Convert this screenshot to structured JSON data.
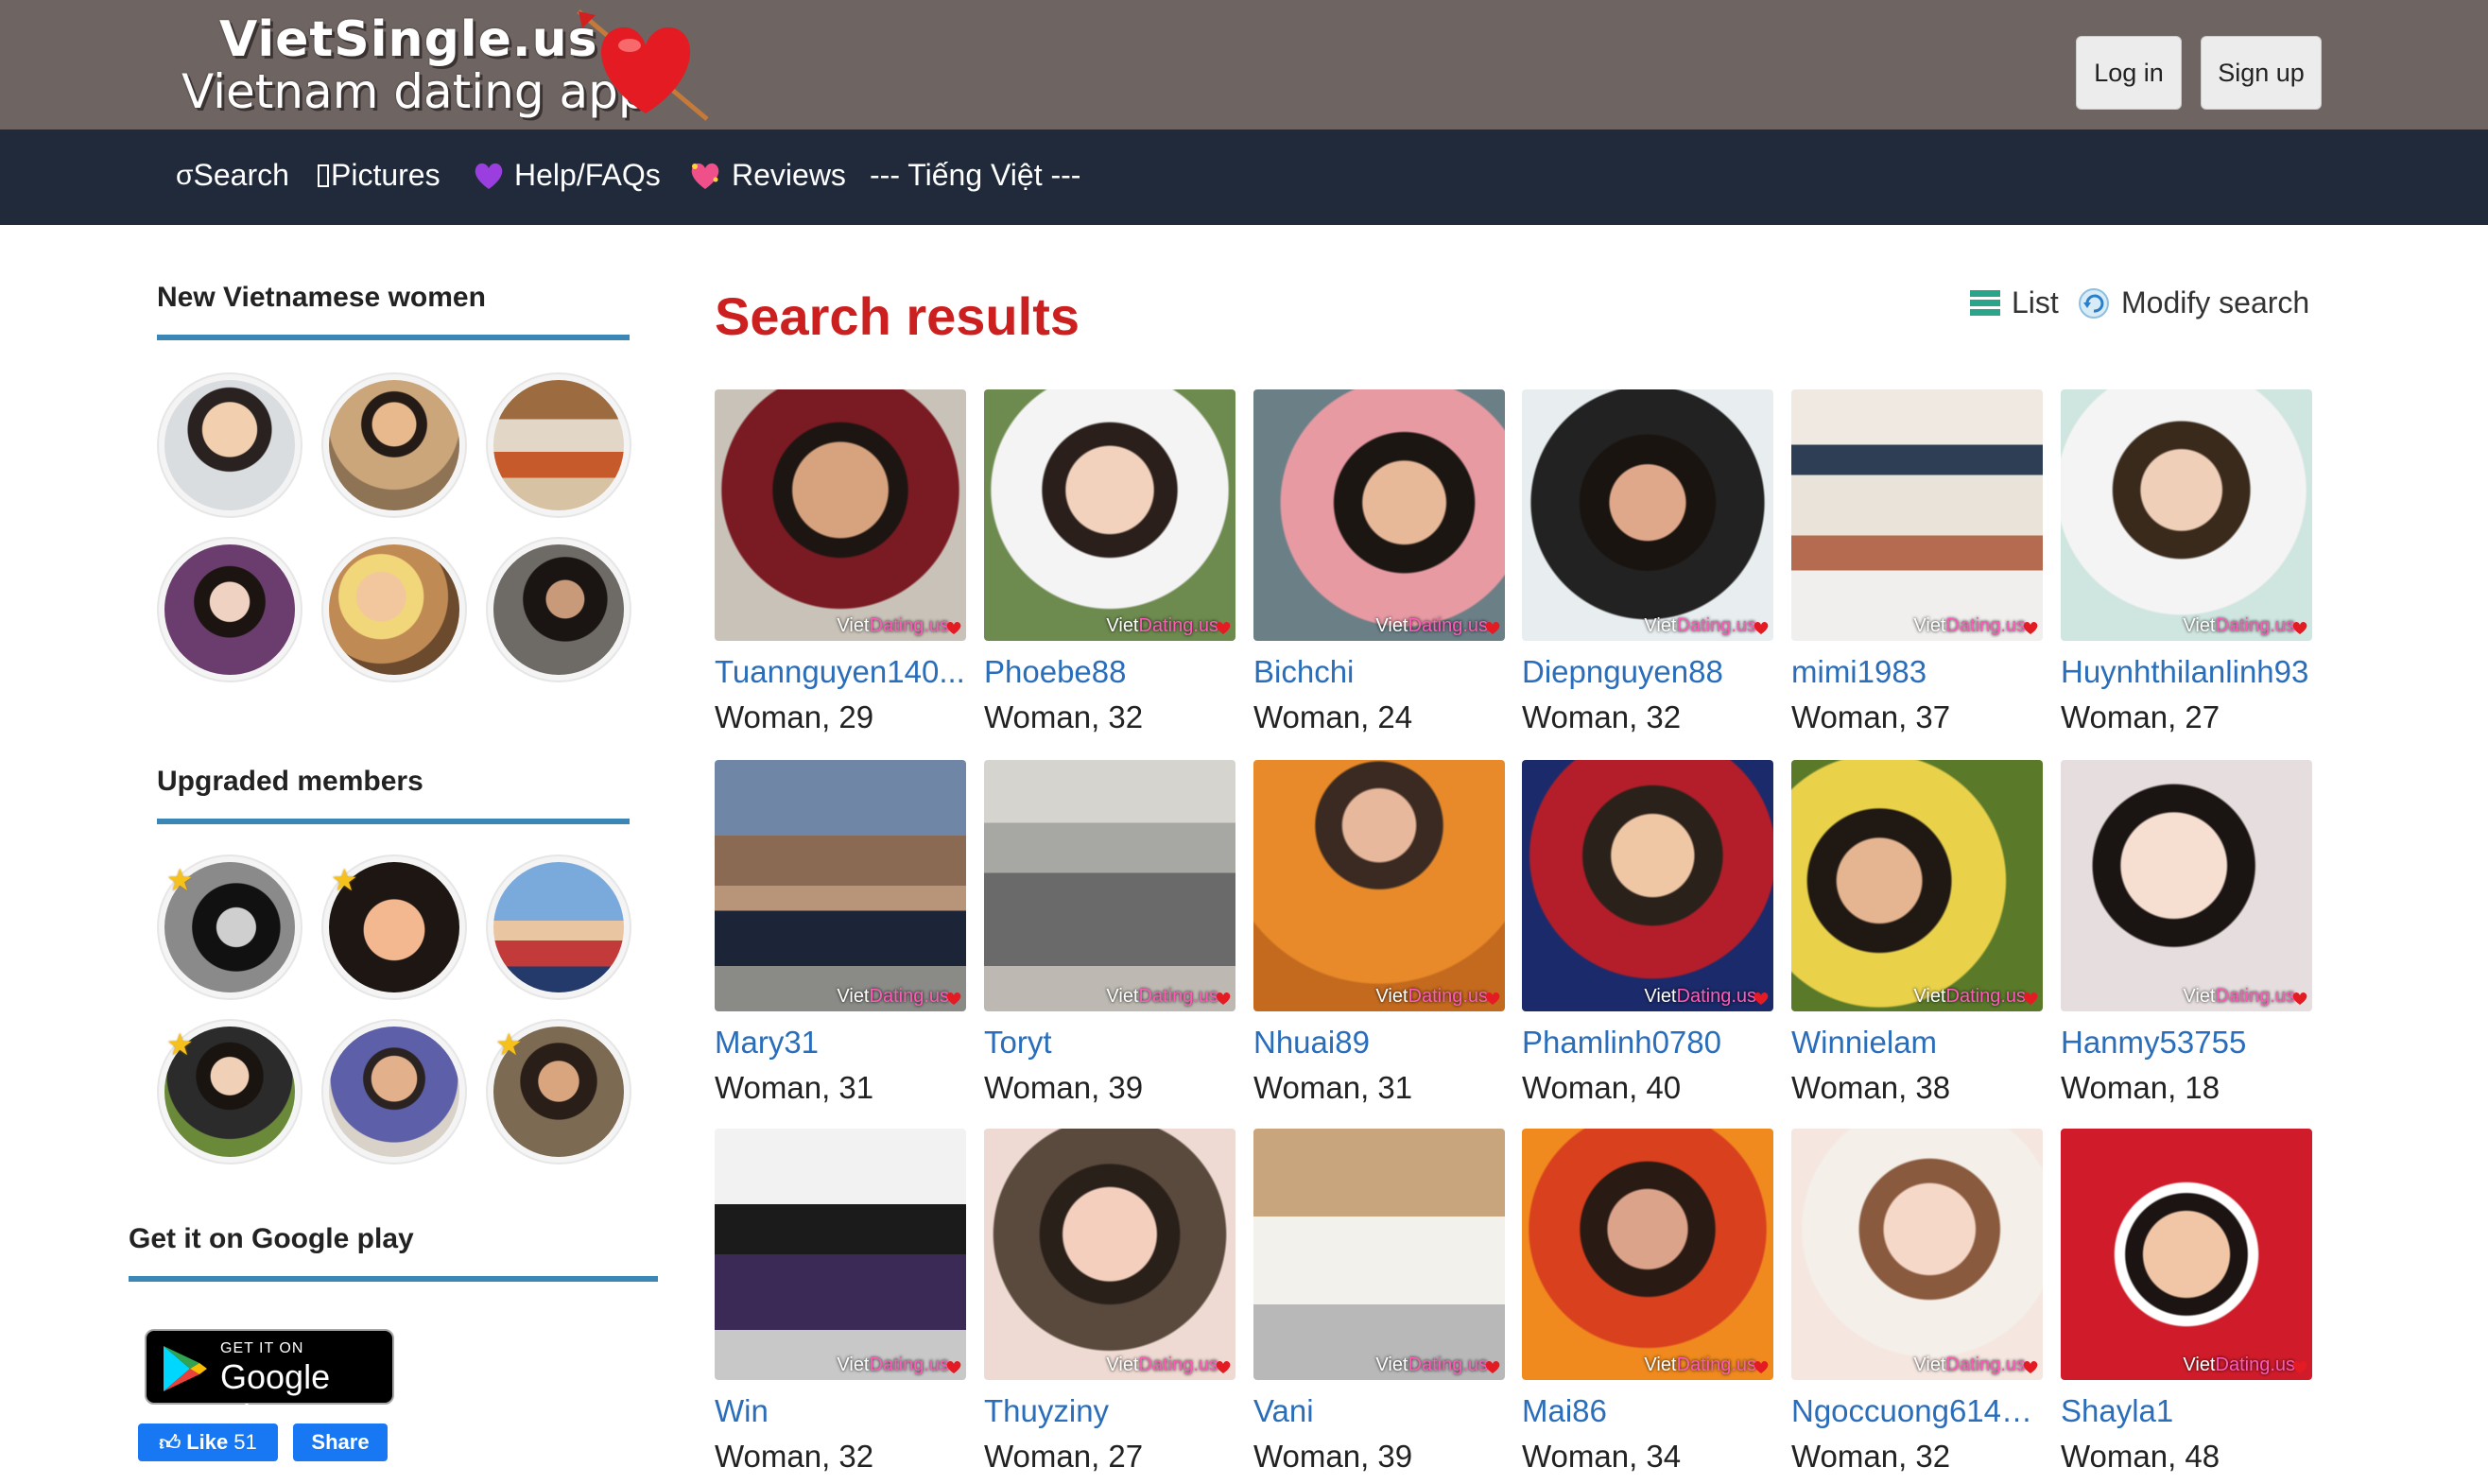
{
  "header": {
    "logo_line1": "VietSingle.us",
    "logo_line2": "Vietnam dating app",
    "login_label": "Log in",
    "signup_label": "Sign up"
  },
  "nav": {
    "search": "Search",
    "pictures": "Pictures",
    "help": "Help/FAQs",
    "reviews": "Reviews",
    "language": "--- Tiếng Việt ---"
  },
  "sidebar": {
    "new_women_title": "New Vietnamese women",
    "upgraded_title": "Upgraded members",
    "google_play_title": "Get it on Google play",
    "google_play_badge_small": "GET IT ON",
    "google_play_badge_big": "Google Play",
    "fb_like_label": "Like",
    "fb_like_count": "51",
    "fb_share_label": "Share"
  },
  "main": {
    "title": "Search results",
    "list_label": "List",
    "modify_label": "Modify search",
    "watermark_viet": "Viet",
    "watermark_dating": "Dating.us"
  },
  "results": [
    {
      "name": "Tuannguyen140...",
      "meta": "Woman, 29"
    },
    {
      "name": "Phoebe88",
      "meta": "Woman, 32"
    },
    {
      "name": "Bichchi",
      "meta": "Woman, 24"
    },
    {
      "name": "Diepnguyen88",
      "meta": "Woman, 32"
    },
    {
      "name": "mimi1983",
      "meta": "Woman, 37"
    },
    {
      "name": "Huynhthilanlinh93",
      "meta": "Woman, 27"
    },
    {
      "name": "Mary31",
      "meta": "Woman, 31"
    },
    {
      "name": "Toryt",
      "meta": "Woman, 39"
    },
    {
      "name": "Nhuai89",
      "meta": "Woman, 31"
    },
    {
      "name": "Phamlinh0780",
      "meta": "Woman, 40"
    },
    {
      "name": "Winnielam",
      "meta": "Woman, 38"
    },
    {
      "name": "Hanmy53755",
      "meta": "Woman, 18"
    },
    {
      "name": "Win",
      "meta": "Woman, 32"
    },
    {
      "name": "Thuyziny",
      "meta": "Woman, 27"
    },
    {
      "name": "Vani",
      "meta": "Woman, 39"
    },
    {
      "name": "Mai86",
      "meta": "Woman, 34"
    },
    {
      "name": "Ngoccuong6148...",
      "meta": "Woman, 32"
    },
    {
      "name": "Shayla1",
      "meta": "Woman, 48"
    }
  ],
  "colors": {
    "header_bg": "#6e6562",
    "nav_bg": "#202a3a",
    "title_red": "#cc1f1f",
    "link_blue": "#2a6ebb",
    "rule_blue": "#3a87b5"
  }
}
